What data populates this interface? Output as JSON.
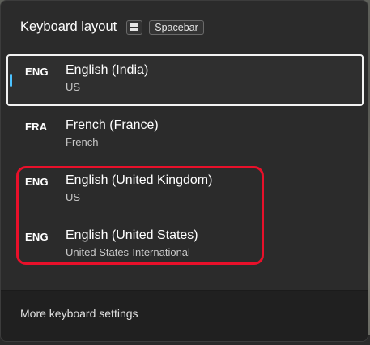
{
  "header": {
    "title": "Keyboard layout",
    "shortcut_win_icon": "windows-logo-icon",
    "shortcut_key": "Spacebar"
  },
  "layouts": [
    {
      "code": "ENG",
      "name": "English (India)",
      "keyboard": "US",
      "selected": true
    },
    {
      "code": "FRA",
      "name": "French (France)",
      "keyboard": "French",
      "selected": false
    },
    {
      "code": "ENG",
      "name": "English (United Kingdom)",
      "keyboard": "US",
      "selected": false
    },
    {
      "code": "ENG",
      "name": "English (United States)",
      "keyboard": "United States-International",
      "selected": false
    }
  ],
  "footer": {
    "link_label": "More keyboard settings"
  },
  "colors": {
    "accent_indicator": "#4cc2ff",
    "highlight_annotation": "#e8102a",
    "flyout_background": "#2b2b2b",
    "footer_background": "#202020"
  }
}
